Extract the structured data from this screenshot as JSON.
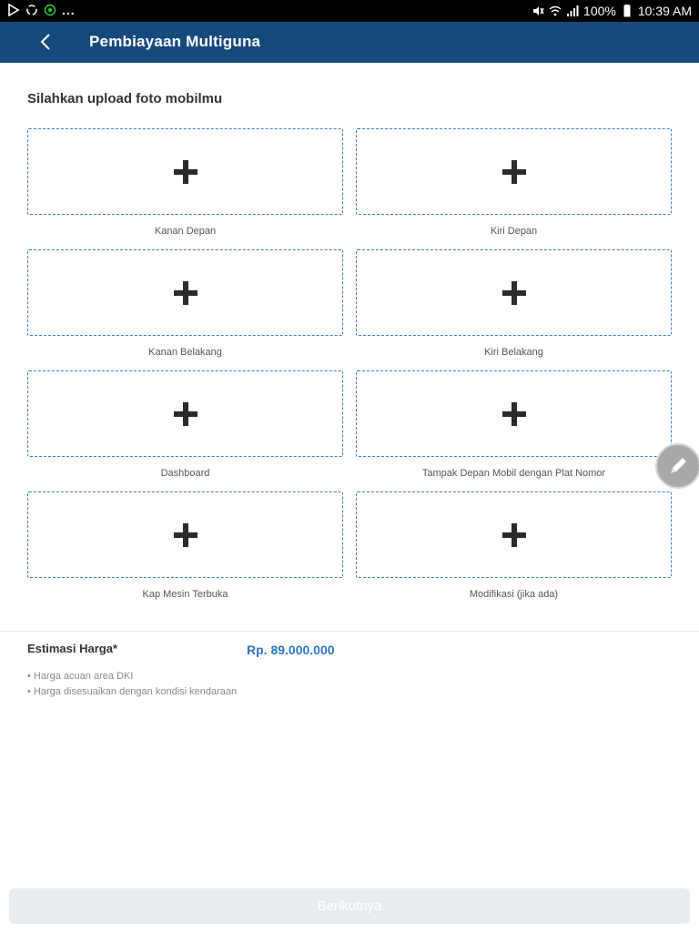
{
  "status_bar": {
    "dots": "...",
    "battery_percent": "100%",
    "time": "10:39 AM",
    "icons": [
      "play-store-icon",
      "sync-icon",
      "app-notification-icon",
      "mute-icon",
      "wifi-icon",
      "signal-icon",
      "battery-icon"
    ]
  },
  "app_bar": {
    "title": "Pembiayaan Multiguna",
    "back_icon": "chevron-left-icon",
    "color": "#174a7c"
  },
  "upload": {
    "heading": "Silahkan upload foto mobilmu",
    "slots": [
      {
        "label": "Kanan Depan"
      },
      {
        "label": "Kiri Depan"
      },
      {
        "label": "Kanan Belakang"
      },
      {
        "label": "Kiri Belakang"
      },
      {
        "label": "Dashboard"
      },
      {
        "label": "Tampak Depan Mobil dengan Plat Nomor"
      },
      {
        "label": "Kap Mesin Terbuka"
      },
      {
        "label": "Modifikasi (jika ada)"
      }
    ],
    "slot_icon": "plus-icon",
    "border_color": "#3a7ec4"
  },
  "estimate": {
    "label": "Estimasi Harga*",
    "value": "Rp. 89.000.000",
    "value_color": "#2a77c4",
    "notes": [
      "• Harga acuan area DKI",
      "• Harga disesuaikan dengan kondisi kendaraan"
    ]
  },
  "fab": {
    "icon": "pencil-icon"
  },
  "footer": {
    "next_label": "Berikutnya"
  }
}
